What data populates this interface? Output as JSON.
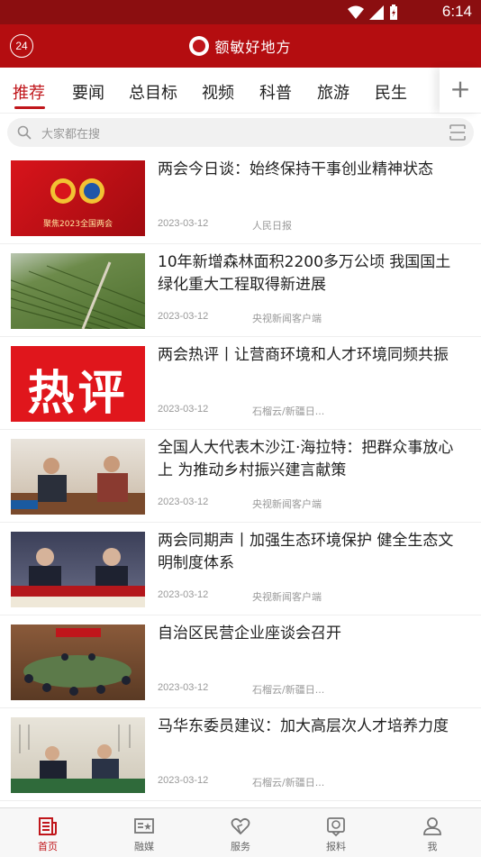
{
  "statusbar": {
    "time": "6:14"
  },
  "appbar": {
    "badge": "24",
    "title": "额敏好地方"
  },
  "tabs": [
    "推荐",
    "要闻",
    "总目标",
    "视频",
    "科普",
    "旅游",
    "民生"
  ],
  "tabs_plus": "+",
  "search": {
    "placeholder": "大家都在搜"
  },
  "articles": [
    {
      "title": "两会今日谈：始终保持干事创业精神状态",
      "date": "2023-03-12",
      "source": "人民日报",
      "thumb_text": "聚焦2023全国两会"
    },
    {
      "title": "10年新增森林面积2200多万公顷 我国国土绿化重大工程取得新进展",
      "date": "2023-03-12",
      "source": "央视新闻客户端",
      "thumb_text": ""
    },
    {
      "title": "两会热评丨让营商环境和人才环境同频共振",
      "date": "2023-03-12",
      "source": "石榴云/新疆日...",
      "thumb_text": "热评"
    },
    {
      "title": "全国人大代表木沙江·海拉特：把群众事放心上 为推动乡村振兴建言献策",
      "date": "2023-03-12",
      "source": "央视新闻客户端",
      "thumb_text": ""
    },
    {
      "title": "两会同期声丨加强生态环境保护 健全生态文明制度体系",
      "date": "2023-03-12",
      "source": "央视新闻客户端",
      "thumb_text": ""
    },
    {
      "title": "自治区民营企业座谈会召开",
      "date": "2023-03-12",
      "source": "石榴云/新疆日...",
      "thumb_text": ""
    },
    {
      "title": "马华东委员建议：加大高层次人才培养力度",
      "date": "2023-03-12",
      "source": "石榴云/新疆日...",
      "thumb_text": ""
    }
  ],
  "bottom_nav": [
    {
      "label": "首页",
      "icon": "news-icon"
    },
    {
      "label": "融媒",
      "icon": "media-icon"
    },
    {
      "label": "服务",
      "icon": "heart-icon"
    },
    {
      "label": "报料",
      "icon": "report-icon"
    },
    {
      "label": "我",
      "icon": "user-icon"
    }
  ],
  "colors": {
    "brand_red": "#b40d10",
    "status_red": "#8b0e10",
    "accent": "#c0161b"
  }
}
